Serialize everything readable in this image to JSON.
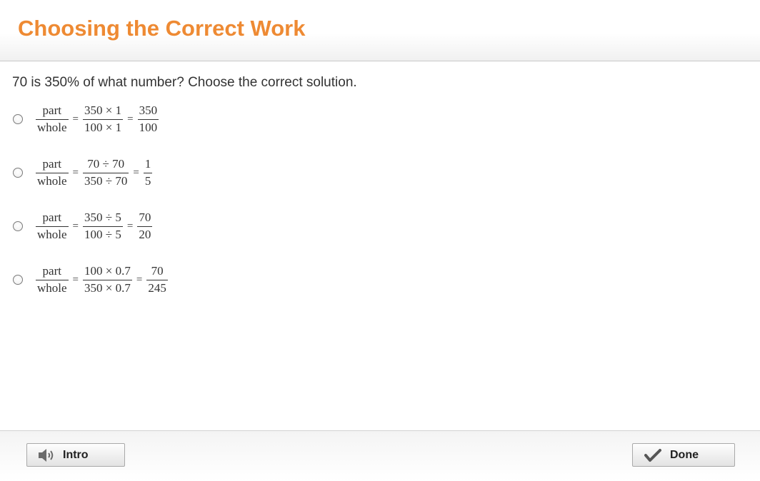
{
  "header": {
    "title": "Choosing the Correct Work",
    "title_color": "#ee8a33"
  },
  "question": {
    "text": "70 is 350% of what number? Choose the correct solution."
  },
  "options": [
    {
      "lhs": {
        "num": "part",
        "den": "whole"
      },
      "mid": {
        "num": "350 × 1",
        "den": "100 × 1"
      },
      "rhs": {
        "num": "350",
        "den": "100"
      }
    },
    {
      "lhs": {
        "num": "part",
        "den": "whole"
      },
      "mid": {
        "num": "70 ÷ 70",
        "den": "350 ÷ 70"
      },
      "rhs": {
        "num": "1",
        "den": "5"
      }
    },
    {
      "lhs": {
        "num": "part",
        "den": "whole"
      },
      "mid": {
        "num": "350 ÷ 5",
        "den": "100 ÷ 5"
      },
      "rhs": {
        "num": "70",
        "den": "20"
      }
    },
    {
      "lhs": {
        "num": "part",
        "den": "whole"
      },
      "mid": {
        "num": "100 × 0.7",
        "den": "350 × 0.7"
      },
      "rhs": {
        "num": "70",
        "den": "245"
      }
    }
  ],
  "equals_sign": "=",
  "footer": {
    "intro_label": "Intro",
    "intro_icon": "speaker-icon",
    "done_label": "Done",
    "done_icon": "checkmark-icon"
  }
}
